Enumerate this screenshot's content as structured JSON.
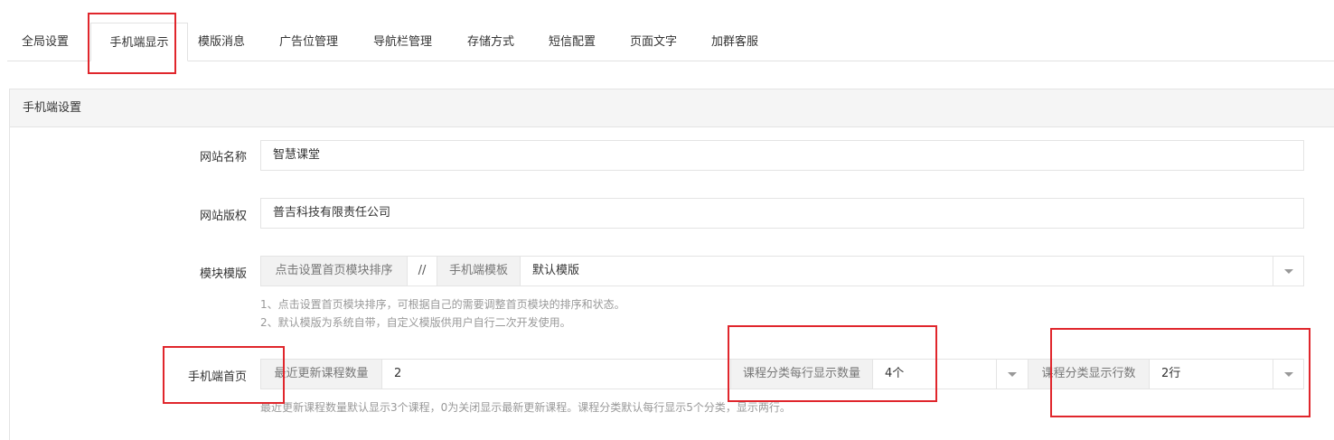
{
  "tabs": [
    "全局设置",
    "手机端显示",
    "模版消息",
    "广告位管理",
    "导航栏管理",
    "存储方式",
    "短信配置",
    "页面文字",
    "加群客服"
  ],
  "active_tab": "手机端显示",
  "panel": {
    "title": "手机端设置"
  },
  "form": {
    "site_name": {
      "label": "网站名称",
      "value": "智慧课堂"
    },
    "copyright": {
      "label": "网站版权",
      "value": "普吉科技有限责任公司"
    },
    "template": {
      "label": "模块模版",
      "sort_button": "点击设置首页模块排序",
      "separator": "//",
      "tpl_label": "手机端模板",
      "tpl_value": "默认模版",
      "help": [
        "1、点击设置首页模块排序，可根据自己的需要调整首页模块的排序和状态。",
        "2、默认模版为系统自带，自定义模版供用户自行二次开发使用。"
      ]
    },
    "home": {
      "label": "手机端首页",
      "recent_label": "最近更新课程数量",
      "recent_value": "2",
      "per_row_label": "课程分类每行显示数量",
      "per_row_value": "4个",
      "rows_label": "课程分类显示行数",
      "rows_value": "2行",
      "help": "最近更新课程数量默认显示3个课程，0为关闭显示最新更新课程。课程分类默认每行显示5个分类，显示两行。"
    }
  },
  "colors": {
    "highlight": "#e0262c",
    "border": "#e4e4e4",
    "addon_bg": "#f2f2f2"
  }
}
